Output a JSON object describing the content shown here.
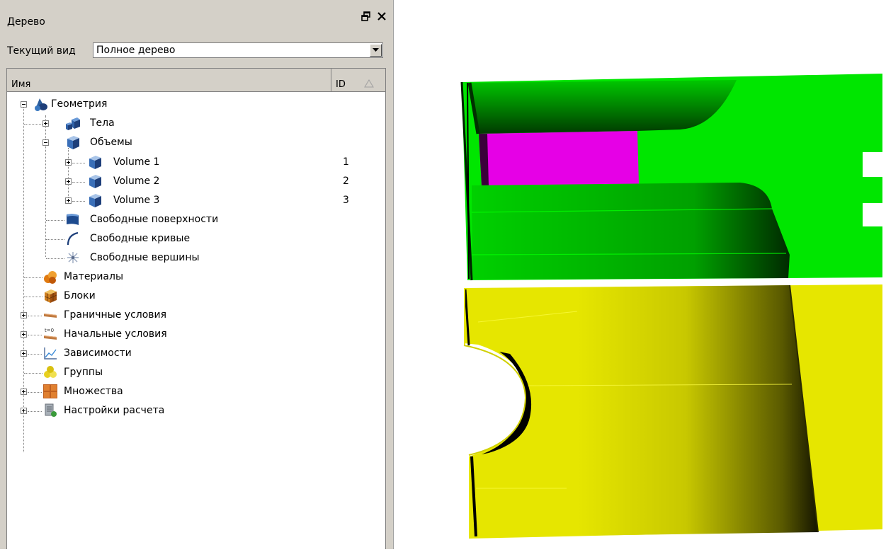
{
  "panel": {
    "title": "Дерево",
    "float_icon": "float-window-icon",
    "close_icon": "close-icon"
  },
  "view_selector": {
    "label": "Текущий вид",
    "value": "Полное дерево"
  },
  "tree": {
    "columns": {
      "name": "Имя",
      "id": "ID"
    },
    "items": {
      "geometry": {
        "label": "Геометрия",
        "icon": "geometry-icon"
      },
      "bodies": {
        "label": "Тела",
        "icon": "bodies-icon"
      },
      "volumes": {
        "label": "Объемы",
        "icon": "volume-cube-icon"
      },
      "volume1": {
        "label": "Volume 1",
        "id": "1",
        "icon": "volume-cube-icon"
      },
      "volume2": {
        "label": "Volume 2",
        "id": "2",
        "icon": "volume-cube-icon"
      },
      "volume3": {
        "label": "Volume 3",
        "id": "3",
        "icon": "volume-cube-icon"
      },
      "free_surfaces": {
        "label": "Свободные поверхности",
        "icon": "surface-icon"
      },
      "free_curves": {
        "label": "Свободные кривые",
        "icon": "curve-icon"
      },
      "free_vertices": {
        "label": "Свободные вершины",
        "icon": "vertex-icon"
      },
      "materials": {
        "label": "Материалы",
        "icon": "materials-icon"
      },
      "blocks": {
        "label": "Блоки",
        "icon": "blocks-icon"
      },
      "boundary_conditions": {
        "label": "Граничные условия",
        "icon": "boundary-conditions-icon"
      },
      "initial_conditions": {
        "label": "Начальные условия",
        "icon": "initial-conditions-icon"
      },
      "dependencies": {
        "label": "Зависимости",
        "icon": "chart-icon"
      },
      "groups": {
        "label": "Группы",
        "icon": "groups-icon"
      },
      "sets": {
        "label": "Множества",
        "icon": "sets-icon"
      },
      "calc_settings": {
        "label": "Настройки расчета",
        "icon": "settings-icon"
      }
    }
  },
  "viewport": {
    "colors": {
      "green": "#00e600",
      "magenta": "#e600e6",
      "yellow": "#e6e600",
      "background": "#ffffff"
    }
  }
}
